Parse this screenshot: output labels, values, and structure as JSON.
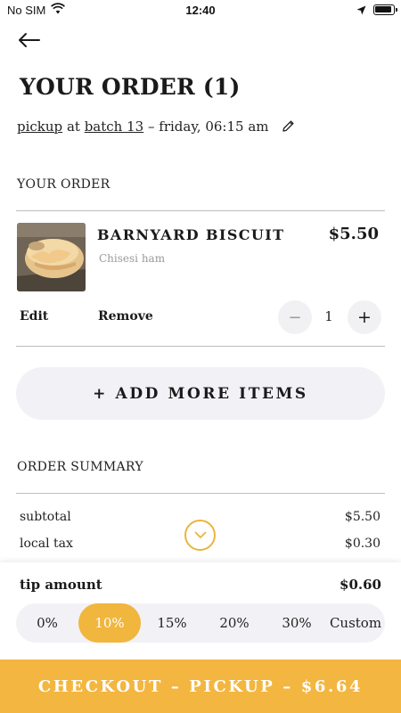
{
  "status_bar": {
    "carrier": "No SIM",
    "time": "12:40"
  },
  "header": {
    "title": "YOUR ORDER (1)"
  },
  "order_info": {
    "method": "pickup",
    "at": "at",
    "location": "batch 13",
    "separator": "–",
    "when": "friday, 06:15 am"
  },
  "order_section": {
    "label": "YOUR ORDER"
  },
  "item": {
    "name": "BARNYARD BISCUIT",
    "price": "$5.50",
    "modifier": "Chisesi ham",
    "edit_label": "Edit",
    "remove_label": "Remove",
    "decrement": "−",
    "quantity": "1",
    "increment": "+"
  },
  "add_more": {
    "label": "+ ADD MORE ITEMS"
  },
  "summary": {
    "label": "ORDER SUMMARY",
    "rows": [
      {
        "label": "subtotal",
        "value": "$5.50"
      },
      {
        "label": "local tax",
        "value": "$0.30"
      }
    ]
  },
  "tip": {
    "label": "tip amount",
    "amount": "$0.60",
    "options": [
      "0%",
      "10%",
      "15%",
      "20%",
      "30%",
      "Custom"
    ],
    "selected": "10%"
  },
  "checkout": {
    "label": "CHECKOUT – PICKUP – $6.64"
  },
  "colors": {
    "accent": "#f3b640",
    "segment_bg": "#f2f2f6",
    "divider": "#bdbdbd"
  }
}
